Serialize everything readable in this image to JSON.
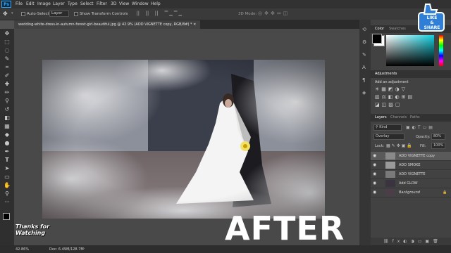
{
  "app": {
    "logo": "Ps"
  },
  "menu": [
    "File",
    "Edit",
    "Image",
    "Layer",
    "Type",
    "Select",
    "Filter",
    "3D",
    "View",
    "Window",
    "Help"
  ],
  "options_bar": {
    "auto_select_label": "Auto-Select:",
    "auto_select_value": "Layer",
    "transform_controls_label": "Show Transform Controls",
    "mode_3d_label": "3D Mode:"
  },
  "document": {
    "tab_title": "wedding-white-dress-in-autumn-forest-girl-beautiful.jpg @ 42.9% (ADD VIGNETTE copy, RGB/8#) *"
  },
  "status": {
    "zoom": "42.86%",
    "doc_info": "Doc: 6.49M/128.7M"
  },
  "panels": {
    "color_tabs": [
      "Color",
      "Swatches"
    ],
    "adjustments_title": "Adjustments",
    "adjustments_subtitle": "Add an adjustment",
    "layers_tabs": [
      "Layers",
      "Channels",
      "Paths"
    ],
    "filter_kind": "Kind",
    "blend_mode": "Overlay",
    "opacity_label": "Opacity:",
    "opacity_value": "80%",
    "lock_label": "Lock:",
    "fill_label": "Fill:",
    "fill_value": "100%",
    "layers": [
      {
        "name": "ADD VIGNETTE copy",
        "selected": true
      },
      {
        "name": "ADD SMOKE",
        "selected": false
      },
      {
        "name": "ADD VIGNETTE",
        "selected": false
      },
      {
        "name": "Add GLOW",
        "selected": false
      },
      {
        "name": "Background",
        "selected": false
      }
    ]
  },
  "overlays": {
    "badge_line1": "LIKE",
    "badge_line2": "& SHARE",
    "thanks_line1": "Thanks for",
    "thanks_line2": "Watching",
    "after_text": "AFTER"
  },
  "colors": {
    "accent": "#31a8ff",
    "badge": "#2f7fd6"
  }
}
